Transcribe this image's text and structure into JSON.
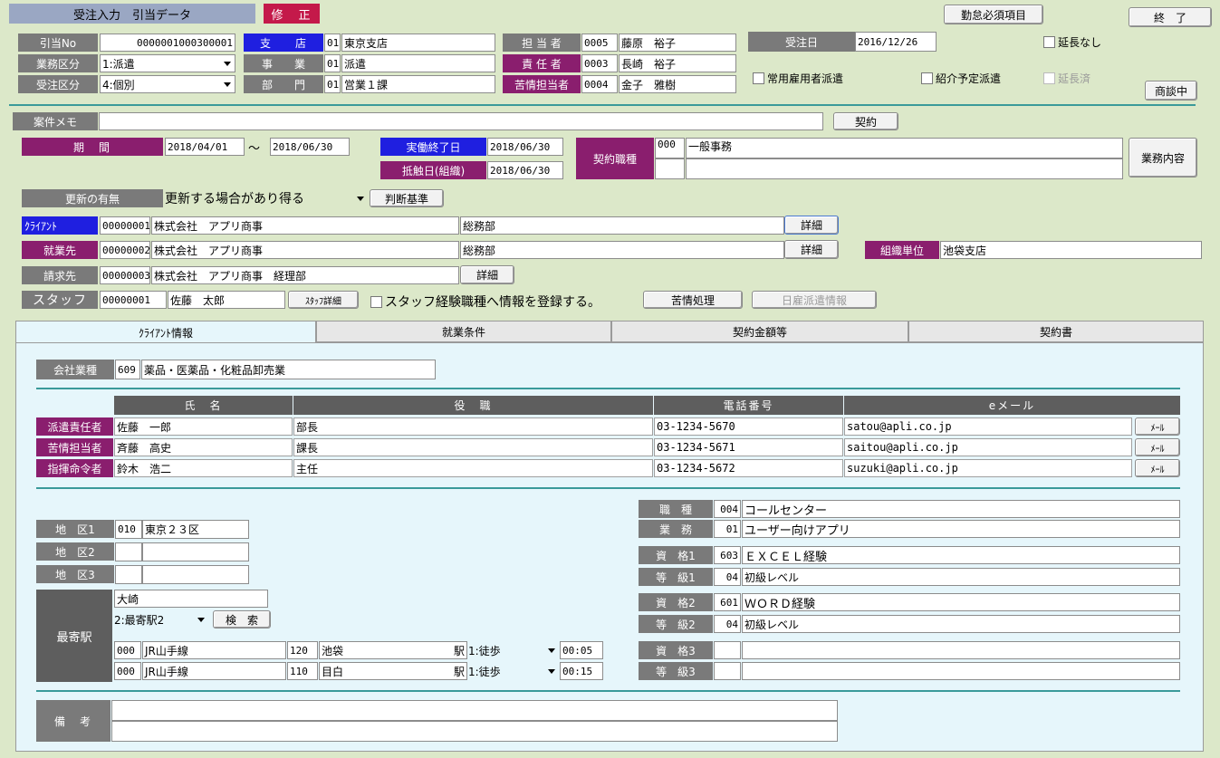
{
  "header": {
    "title": "受注入力　引当データ",
    "mode": "修　正",
    "required_btn": "勤怠必須項目",
    "exit_btn": "終　了"
  },
  "top": {
    "hikiate_label": "引当No",
    "hikiate_no": "0000001000300001",
    "gyomu_label": "業務区分",
    "gyomu_value": "1:派遣",
    "juchu_kubun_label": "受注区分",
    "juchu_kubun_value": "4:個別",
    "shiten_label": "支　　店",
    "shiten_code": "01",
    "shiten_name": "東京支店",
    "jigyo_label": "事　　業",
    "jigyo_code": "01",
    "jigyo_name": "派遣",
    "bumon_label": "部　　門",
    "bumon_code": "01",
    "bumon_name": "営業１課",
    "tanto_label": "担 当 者",
    "tanto_code": "0005",
    "tanto_name": "藤原　裕子",
    "sekinin_label": "責 任 者",
    "sekinin_code": "0003",
    "sekinin_name": "長崎　裕子",
    "kujo_label": "苦情担当者",
    "kujo_code": "0004",
    "kujo_name": "金子　雅樹",
    "juchubi_label": "受注日",
    "juchubi": "2016/12/26",
    "encho_nashi": "延長なし",
    "joyo": "常用雇用者派遣",
    "shokai": "紹介予定派遣",
    "encho_zumi": "延長済",
    "shodan_btn": "商談中"
  },
  "memo": {
    "label": "案件メモ",
    "value": "",
    "keiyaku_btn": "契約"
  },
  "period": {
    "label": "期　間",
    "from": "2018/04/01",
    "tilde": "～",
    "to": "2018/06/30",
    "jitsudo_label": "実働終了日",
    "jitsudo": "2018/06/30",
    "teishoku_label": "抵触日(組織)",
    "teishoku": "2018/06/30",
    "shokushu_label": "契約職種",
    "shokushu_code": "000",
    "shokushu_name": "一般事務",
    "gyomu_naiyo_btn": "業務内容"
  },
  "renewal": {
    "label": "更新の有無",
    "value": "更新する場合があり得る",
    "btn": "判断基準"
  },
  "client": {
    "label": "ｸﾗｲｱﾝﾄ",
    "code": "00000001",
    "name": "株式会社　アプリ商事",
    "dept": "総務部",
    "btn": "詳細"
  },
  "shugyo": {
    "label": "就業先",
    "code": "00000002",
    "name": "株式会社　アプリ商事",
    "dept": "総務部",
    "btn": "詳細",
    "soshiki_label": "組織単位",
    "soshiki": "池袋支店"
  },
  "seikyu": {
    "label": "請求先",
    "code": "00000003",
    "name": "株式会社　アプリ商事　経理部",
    "btn": "詳細"
  },
  "staff": {
    "label": "スタッフ",
    "code": "00000001",
    "name": "佐藤　太郎",
    "detail_btn": "ｽﾀｯﾌ詳細",
    "register": "スタッフ経験職種へ情報を登録する。",
    "kujo_btn": "苦情処理",
    "hiyatoi_btn": "日雇派遣情報"
  },
  "tabs": [
    "ｸﾗｲｱﾝﾄ情報",
    "就業条件",
    "契約金額等",
    "契約書"
  ],
  "industry": {
    "label": "会社業種",
    "code": "609",
    "name": "薬品・医薬品・化粧品卸売業"
  },
  "contacts": {
    "headers": [
      "氏　名",
      "役　職",
      "電話番号",
      "eメール"
    ],
    "mail_btn": "ﾒｰﾙ",
    "rows": [
      {
        "role": "派遣責任者",
        "name": "佐藤　一郎",
        "title": "部長",
        "tel": "03-1234-5670",
        "email": "satou@apli.co.jp"
      },
      {
        "role": "苦情担当者",
        "name": "斉藤　高史",
        "title": "課長",
        "tel": "03-1234-5671",
        "email": "saitou@apli.co.jp"
      },
      {
        "role": "指揮命令者",
        "name": "鈴木　浩二",
        "title": "主任",
        "tel": "03-1234-5672",
        "email": "suzuki@apli.co.jp"
      }
    ]
  },
  "area": {
    "l1": "地　区1",
    "c1": "010",
    "n1": "東京２３区",
    "l2": "地　区2",
    "l3": "地　区3"
  },
  "station": {
    "label": "最寄駅",
    "name": "大崎",
    "select": "2:最寄駅2",
    "search": "検　索",
    "rows": [
      {
        "lc": "000",
        "line": "JR山手線",
        "sc": "120",
        "st": "池袋",
        "eki": "駅",
        "how": "1:徒歩",
        "time": "00:05"
      },
      {
        "lc": "000",
        "line": "JR山手線",
        "sc": "110",
        "st": "目白",
        "eki": "駅",
        "how": "1:徒歩",
        "time": "00:15"
      }
    ]
  },
  "job": {
    "shokushu_label": "職　種",
    "shokushu_code": "004",
    "shokushu": "コールセンター",
    "gyomu_label": "業　務",
    "gyomu_code": "01",
    "gyomu": "ユーザー向けアプリ",
    "q1_label": "資　格1",
    "q1_code": "603",
    "q1": "ＥＸＣＥＬ経験",
    "g1_label": "等　級1",
    "g1_code": "04",
    "g1": "初級レベル",
    "q2_label": "資　格2",
    "q2_code": "601",
    "q2": "ＷＯＲＤ経験",
    "g2_label": "等　級2",
    "g2_code": "04",
    "g2": "初級レベル",
    "q3_label": "資　格3",
    "g3_label": "等　級3"
  },
  "biko": {
    "label": "備　考"
  }
}
